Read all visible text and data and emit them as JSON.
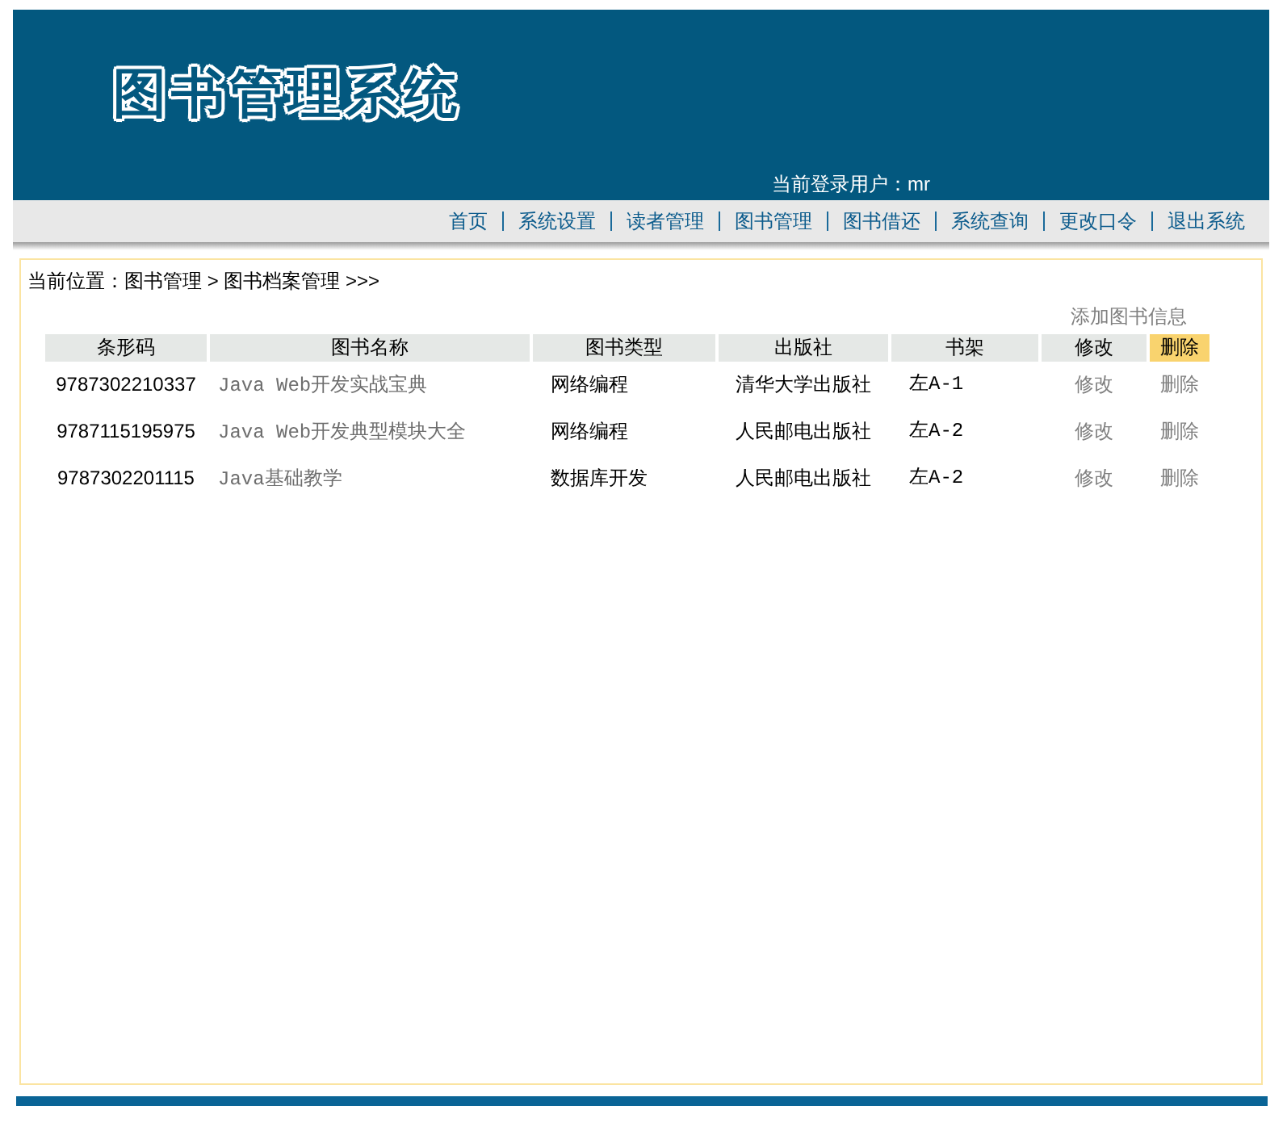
{
  "header": {
    "logo": "图书管理系统",
    "login_user": "当前登录用户：mr"
  },
  "nav": [
    "首页",
    "系统设置",
    "读者管理",
    "图书管理",
    "图书借还",
    "系统查询",
    "更改口令",
    "退出系统"
  ],
  "content": {
    "breadcrumb": "当前位置：图书管理 > 图书档案管理 >>>",
    "add_link": "添加图书信息",
    "table": {
      "columns": [
        {
          "label": "条形码",
          "highlighted": false
        },
        {
          "label": "图书名称",
          "highlighted": false
        },
        {
          "label": "图书类型",
          "highlighted": false
        },
        {
          "label": "出版社",
          "highlighted": false
        },
        {
          "label": "书架",
          "highlighted": false
        },
        {
          "label": "修改",
          "highlighted": false
        },
        {
          "label": "删除",
          "highlighted": true
        }
      ],
      "rows": [
        {
          "barcode": "9787302210337",
          "title": "Java Web开发实战宝典",
          "type": "网络编程",
          "publisher": "清华大学出版社",
          "shelf": "左A-1",
          "edit": "修改",
          "delete": "删除"
        },
        {
          "barcode": "9787115195975",
          "title": "Java Web开发典型模块大全",
          "type": "网络编程",
          "publisher": "人民邮电出版社",
          "shelf": "左A-2",
          "edit": "修改",
          "delete": "删除"
        },
        {
          "barcode": "9787302201115",
          "title": "Java基础教学",
          "type": "数据库开发",
          "publisher": "人民邮电出版社",
          "shelf": "左A-2",
          "edit": "修改",
          "delete": "删除"
        }
      ]
    }
  }
}
